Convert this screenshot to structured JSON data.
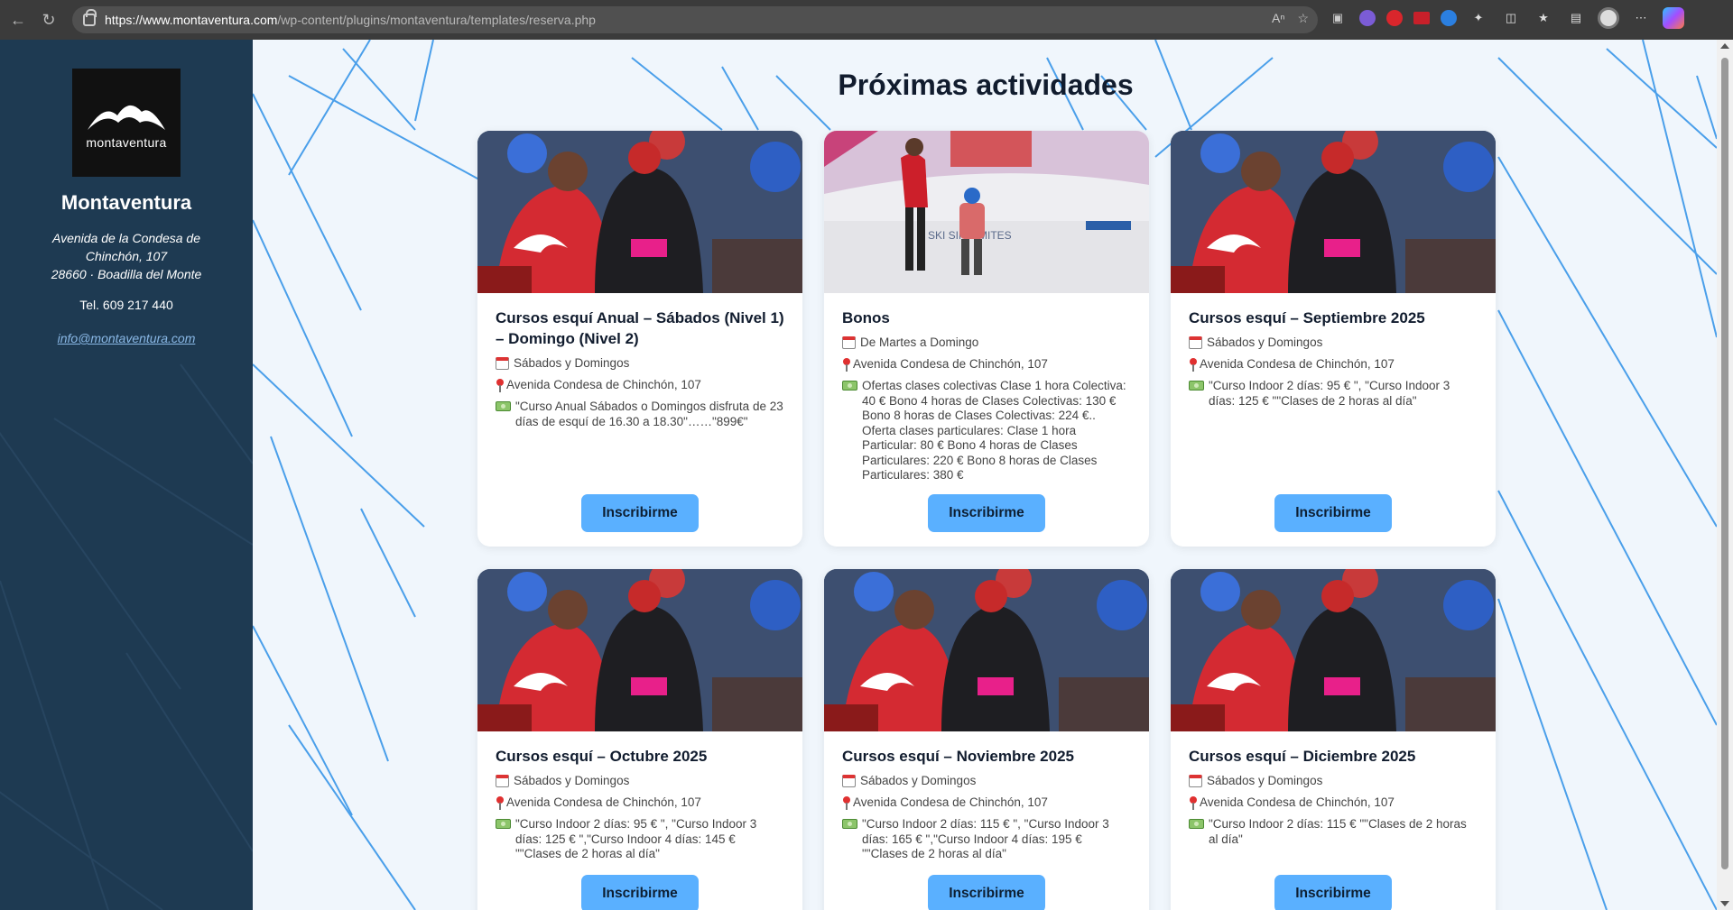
{
  "browser": {
    "url_host": "https://www.montaventura.com",
    "url_path": "/wp-content/plugins/montaventura/templates/reserva.php"
  },
  "sidebar": {
    "logo_text": "montaventura",
    "brand": "Montaventura",
    "address_line1": "Avenida de la Condesa de Chinchón, 107",
    "address_line2": "28660 · Boadilla del Monte",
    "phone": "Tel. 609 217 440",
    "email": "info@montaventura.com"
  },
  "main": {
    "title": "Próximas actividades",
    "button_label": "Inscribirme",
    "cards": [
      {
        "title": "Cursos esquí Anual – Sábados (Nivel 1) – Domingo (Nivel 2)",
        "schedule": "Sábados y Domingos",
        "location": "Avenida Condesa de Chinchón, 107",
        "description": "\"Curso Anual Sábados o Domingos disfruta de 23 días de esquí de 16.30 a 18.30\"……\"899€\"",
        "image": "kids-ski-class"
      },
      {
        "title": "Bonos",
        "schedule": "De Martes a Domingo",
        "location": "Avenida Condesa de Chinchón, 107",
        "description": "Ofertas clases colectivas Clase 1 hora Colectiva: 40 € Bono 4 horas de Clases Colectivas: 130 € Bono 8 horas de Clases Colectivas: 224 €.. Oferta clases particulares: Clase 1 hora Particular:  80 €  Bono 4 horas de Clases Particulares: 220 € Bono 8 horas de Clases Particulares: 380 €",
        "image": "indoor-ski-slope"
      },
      {
        "title": "Cursos esquí – Septiembre 2025",
        "schedule": "Sábados y Domingos",
        "location": "Avenida Condesa de Chinchón, 107",
        "description": "\"Curso Indoor 2 días: 95 € \", \"Curso Indoor 3 días: 125 € \"\"Clases de 2 horas al día\"",
        "image": "kids-ski-class"
      },
      {
        "title": "Cursos esquí – Octubre 2025",
        "schedule": "Sábados y Domingos",
        "location": "Avenida Condesa de Chinchón, 107",
        "description": "\"Curso Indoor 2 días: 95 € \", \"Curso Indoor 3 días: 125 € \",\"Curso Indoor 4 días: 145 €  \"\"Clases de 2 horas al día\"",
        "image": "kids-ski-class"
      },
      {
        "title": "Cursos esquí – Noviembre 2025",
        "schedule": "Sábados y Domingos",
        "location": "Avenida Condesa de Chinchón, 107",
        "description": "\"Curso Indoor 2 días: 115 € \", \"Curso Indoor 3 días: 165 € \",\"Curso Indoor 4 días: 195 €  \"\"Clases de 2 horas al día\"",
        "image": "kids-ski-class"
      },
      {
        "title": "Cursos esquí – Diciembre 2025",
        "schedule": "Sábados y Domingos",
        "location": "Avenida Condesa de Chinchón, 107",
        "description": "\"Curso Indoor 2 días: 115 € \"\"Clases de 2 horas al día\"",
        "image": "kids-ski-class"
      }
    ]
  },
  "colors": {
    "sidebar_bg": "#1e3a52",
    "accent_button": "#5ab0ff",
    "line_pattern": "#4a9fea"
  }
}
